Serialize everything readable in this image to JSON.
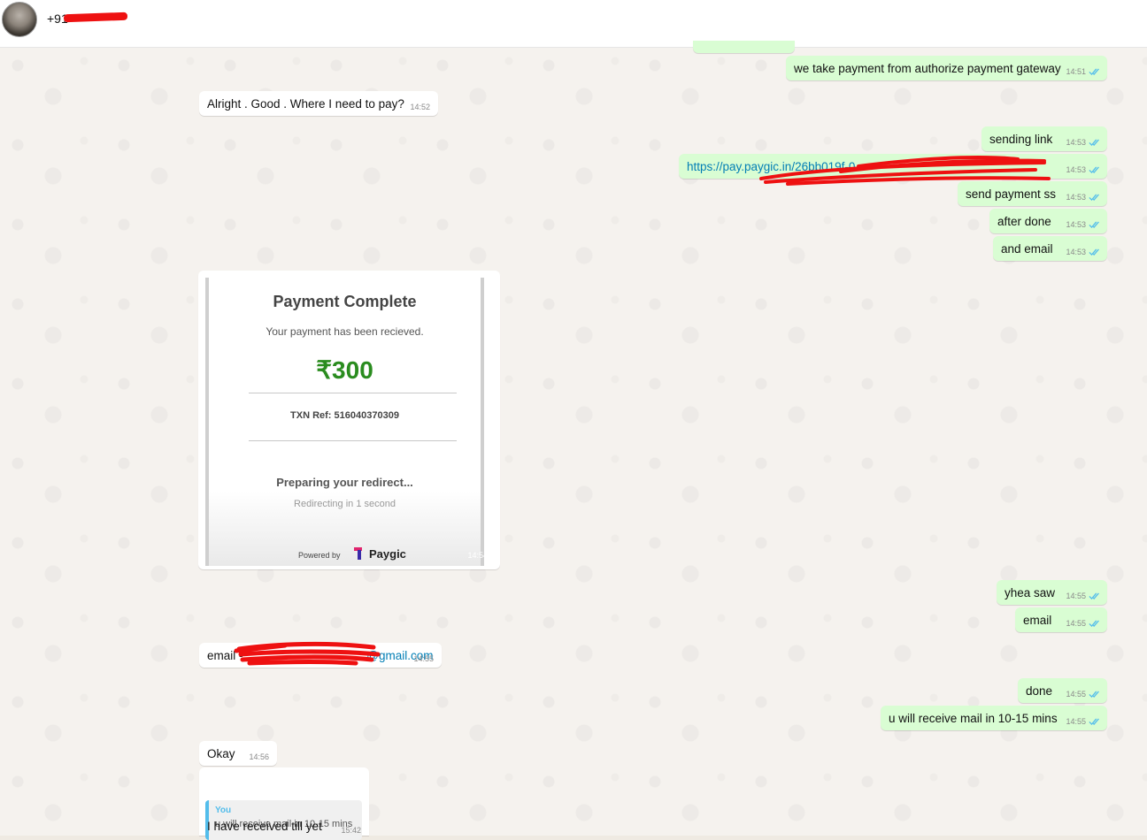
{
  "header": {
    "contact_name": "+91"
  },
  "messages": [
    {
      "text": "we take payment from authorize payment gateway",
      "time": "14:51"
    },
    {
      "text": "Alright . Good . Where I need to pay?",
      "time": "14:52"
    },
    {
      "text": "sending link",
      "time": "14:53"
    },
    {
      "text": "https://pay.paygic.in/26bb019f-0",
      "time": "14:53"
    },
    {
      "text": "send payment ss",
      "time": "14:53"
    },
    {
      "text": "after done",
      "time": "14:53"
    },
    {
      "text": "and email",
      "time": "14:53"
    },
    {
      "text": "yhea saw",
      "time": "14:55"
    },
    {
      "text": "email",
      "time": "14:55"
    },
    {
      "text_prefix": "email - ",
      "link": "@gmail.com",
      "time": "14:55"
    },
    {
      "text": "done",
      "time": "14:55"
    },
    {
      "text": "u will receive mail in 10-15 mins",
      "time": "14:55"
    },
    {
      "text": "Okay",
      "time": "14:56"
    },
    {
      "text": "I have received till yet",
      "time": "15:42",
      "quote_author": "You",
      "quote_text": "u will receive mail in 10-15 mins"
    }
  ],
  "receipt": {
    "title": "Payment Complete",
    "subtitle": "Your payment has been recieved.",
    "amount": "₹300",
    "txn_ref": "TXN Ref: 516040370309",
    "preparing": "Preparing your redirect...",
    "redirecting": "Redirecting in 1 second",
    "powered_by": "Powered by",
    "brand": "Paygic",
    "time": "14:54"
  },
  "colors": {
    "outgoing_bubble": "#d9fdd3",
    "incoming_bubble": "#ffffff",
    "read_tick": "#53bdeb",
    "link": "#027eb5",
    "amount_green": "#2a8c1f",
    "redaction": "#ee1111"
  }
}
